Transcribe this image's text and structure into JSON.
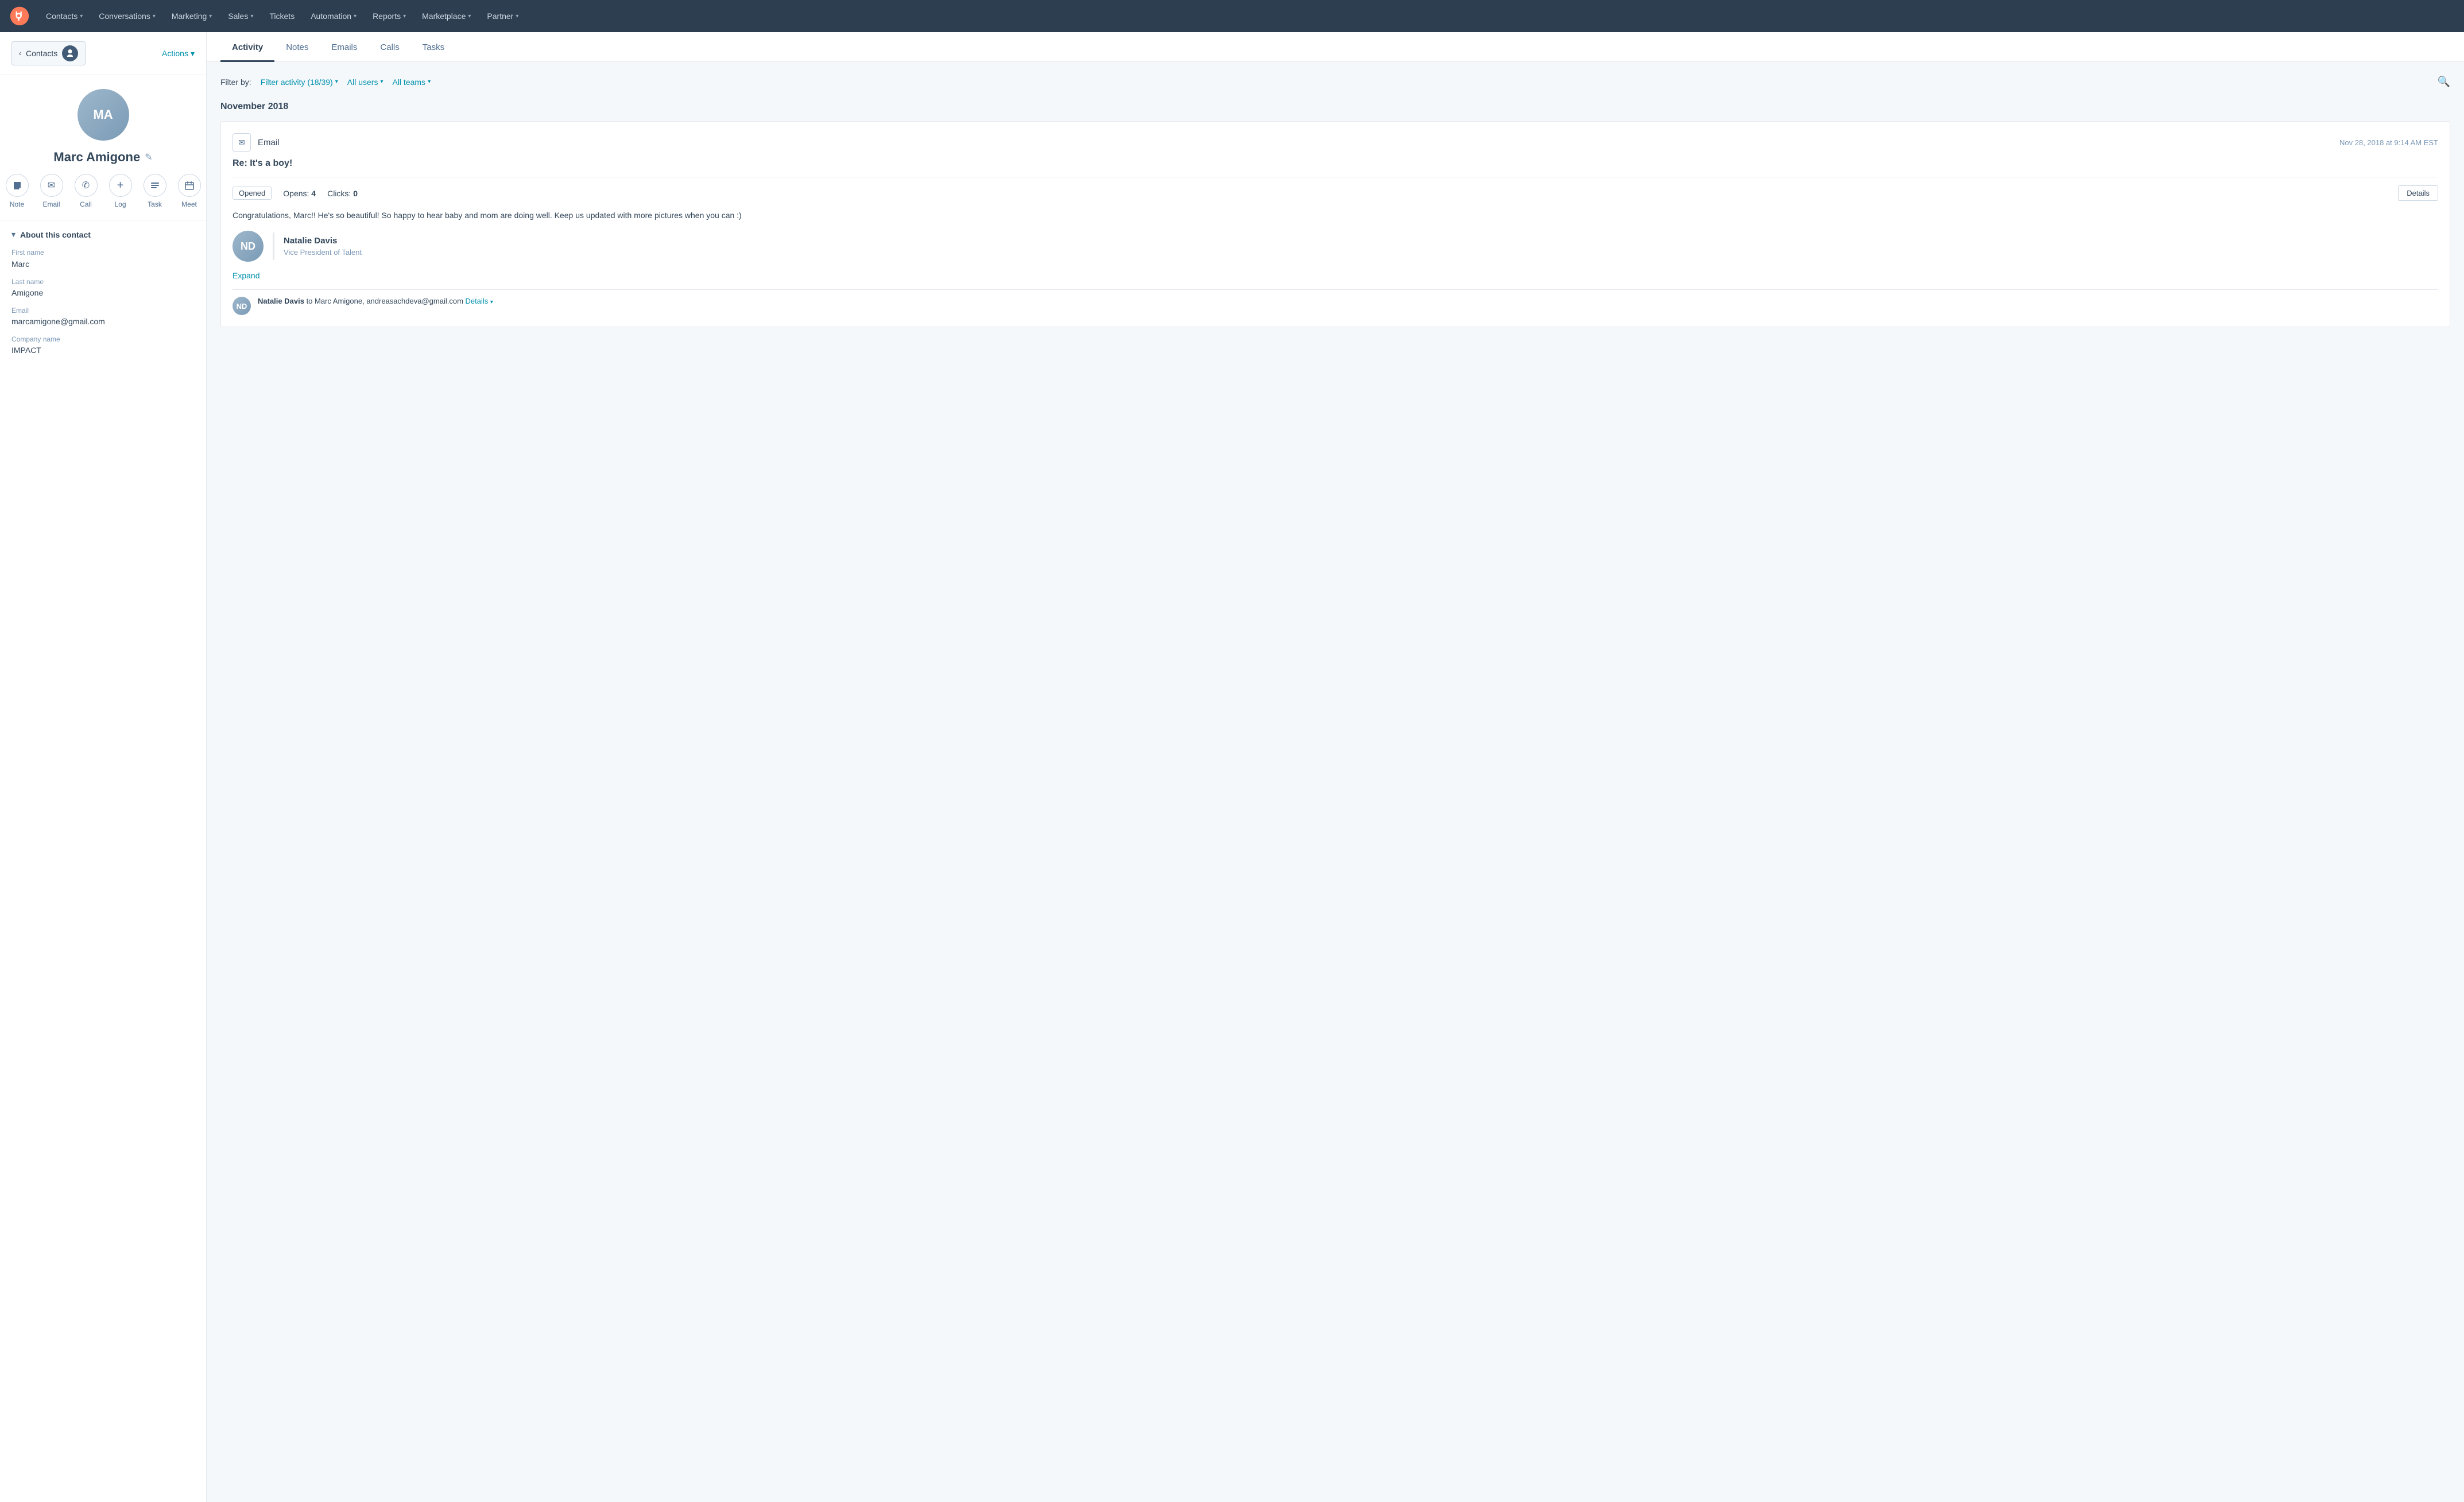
{
  "nav": {
    "items": [
      {
        "label": "Contacts",
        "hasChevron": true
      },
      {
        "label": "Conversations",
        "hasChevron": true
      },
      {
        "label": "Marketing",
        "hasChevron": true
      },
      {
        "label": "Sales",
        "hasChevron": true
      },
      {
        "label": "Tickets",
        "hasChevron": false
      },
      {
        "label": "Automation",
        "hasChevron": true
      },
      {
        "label": "Reports",
        "hasChevron": true
      },
      {
        "label": "Marketplace",
        "hasChevron": true
      },
      {
        "label": "Partner",
        "hasChevron": true
      }
    ]
  },
  "sidebar": {
    "back_label": "Contacts",
    "actions_label": "Actions",
    "contact_name": "Marc Amigone",
    "action_buttons": [
      {
        "label": "Note",
        "icon": "✎"
      },
      {
        "label": "Email",
        "icon": "✉"
      },
      {
        "label": "Call",
        "icon": "✆"
      },
      {
        "label": "Log",
        "icon": "+"
      },
      {
        "label": "Task",
        "icon": "☰"
      },
      {
        "label": "Meet",
        "icon": "📅"
      }
    ],
    "about_title": "About this contact",
    "fields": [
      {
        "label": "First name",
        "value": "Marc"
      },
      {
        "label": "Last name",
        "value": "Amigone"
      },
      {
        "label": "Email",
        "value": "marcamigone@gmail.com"
      },
      {
        "label": "Company name",
        "value": "IMPACT"
      }
    ]
  },
  "tabs": [
    {
      "label": "Activity",
      "active": true
    },
    {
      "label": "Notes"
    },
    {
      "label": "Emails"
    },
    {
      "label": "Calls"
    },
    {
      "label": "Tasks"
    }
  ],
  "filters": {
    "label": "Filter by:",
    "activity_filter": "Filter activity (18/39)",
    "users_filter": "All users",
    "teams_filter": "All teams"
  },
  "month_header": "November 2018",
  "email_card": {
    "type": "Email",
    "timestamp": "Nov 28, 2018 at 9:14 AM EST",
    "subject": "Re: It's a boy!",
    "badge_opened": "Opened",
    "opens_label": "Opens:",
    "opens_value": "4",
    "clicks_label": "Clicks:",
    "clicks_value": "0",
    "details_btn": "Details",
    "body_text": "Congratulations, Marc!! He's so beautiful! So happy to hear baby and mom are doing well. Keep us updated with more pictures when you can :)",
    "sender_name": "Natalie Davis",
    "sender_title": "Vice President of Talent",
    "expand_label": "Expand",
    "reply_name": "Natalie Davis",
    "reply_to_text": "to Marc Amigone, andreasachdeva@gmail.com",
    "reply_details": "Details"
  }
}
